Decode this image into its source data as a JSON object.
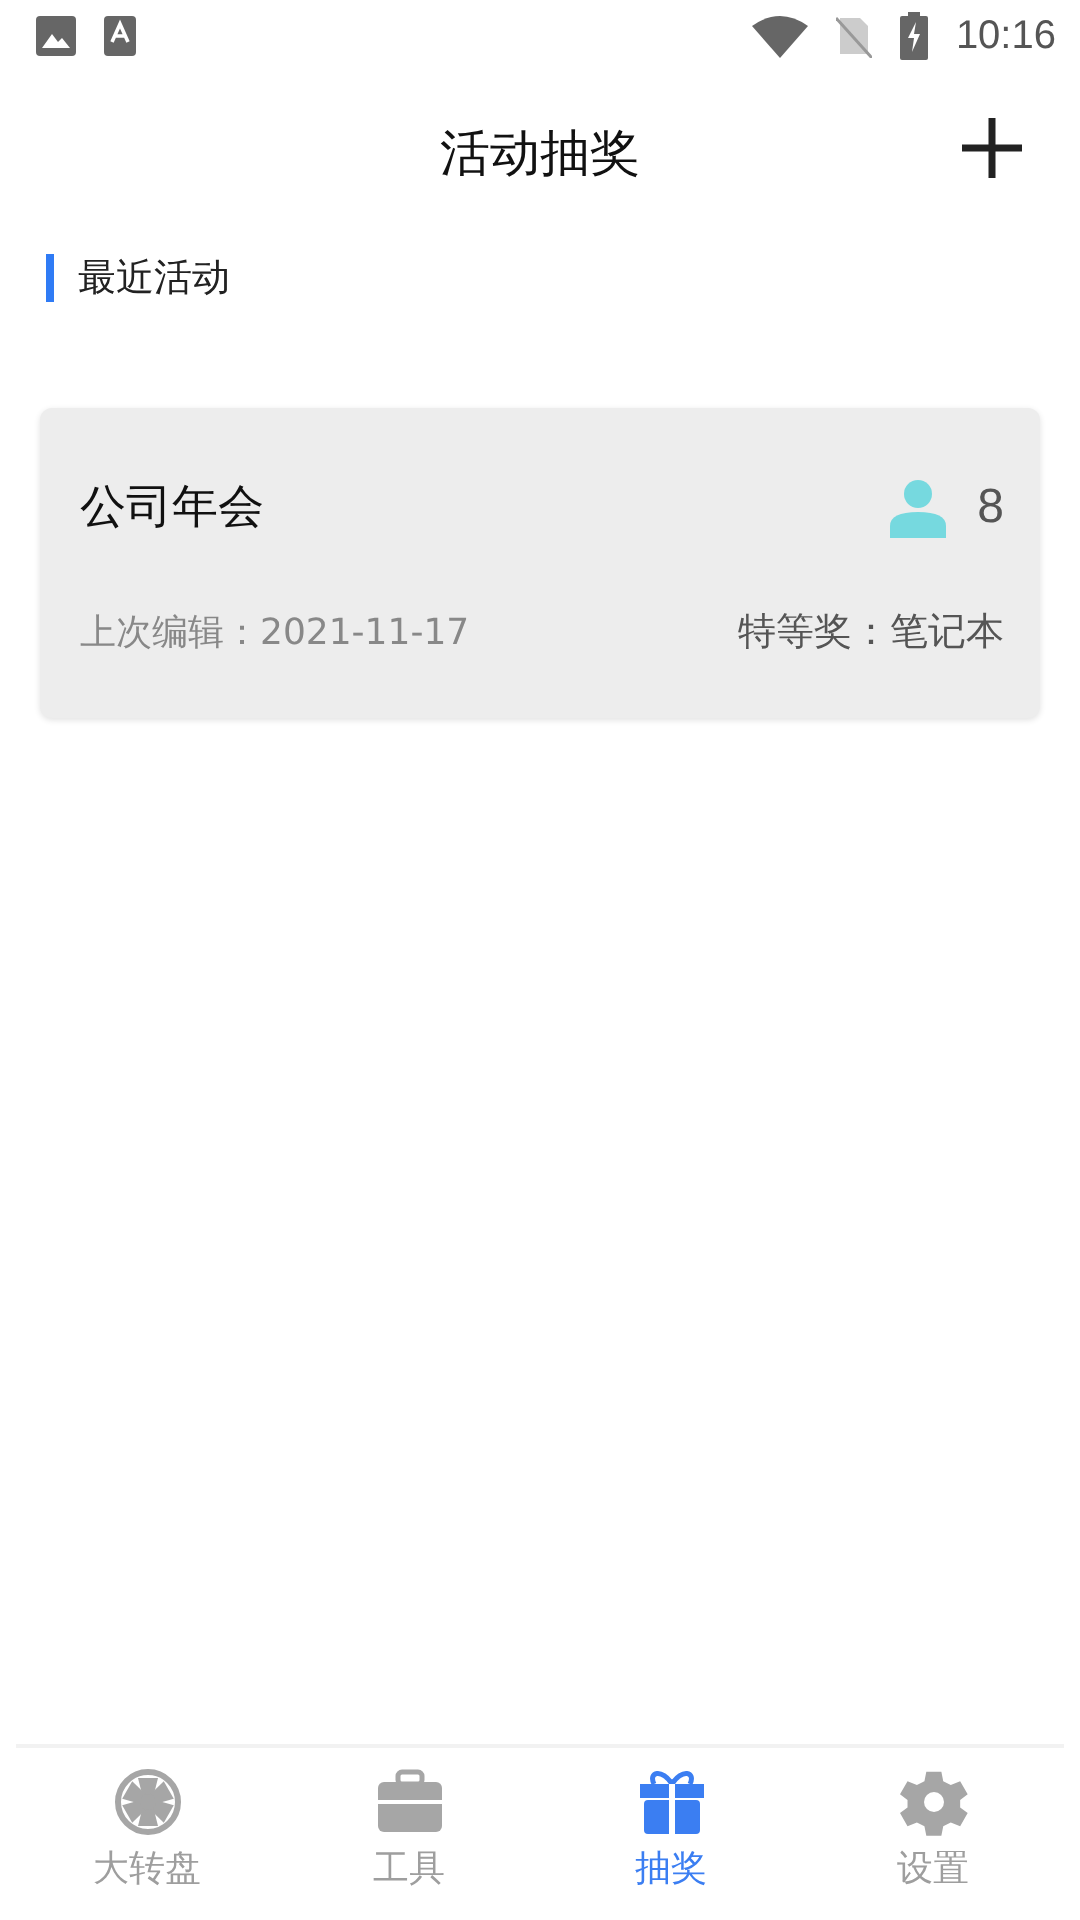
{
  "status_bar": {
    "time": "10:16"
  },
  "header": {
    "title": "活动抽奖"
  },
  "section": {
    "title": "最近活动"
  },
  "activities": [
    {
      "name": "公司年会",
      "participants": "8",
      "last_edited": "上次编辑：2021-11-17",
      "prize": "特等奖：笔记本"
    }
  ],
  "tabs": [
    {
      "kind": "wheel",
      "label": "大转盘",
      "selected": false
    },
    {
      "kind": "toolbox",
      "label": "工具",
      "selected": false
    },
    {
      "kind": "gift",
      "label": "抽奖",
      "selected": true
    },
    {
      "kind": "gear",
      "label": "设置",
      "selected": false
    }
  ]
}
